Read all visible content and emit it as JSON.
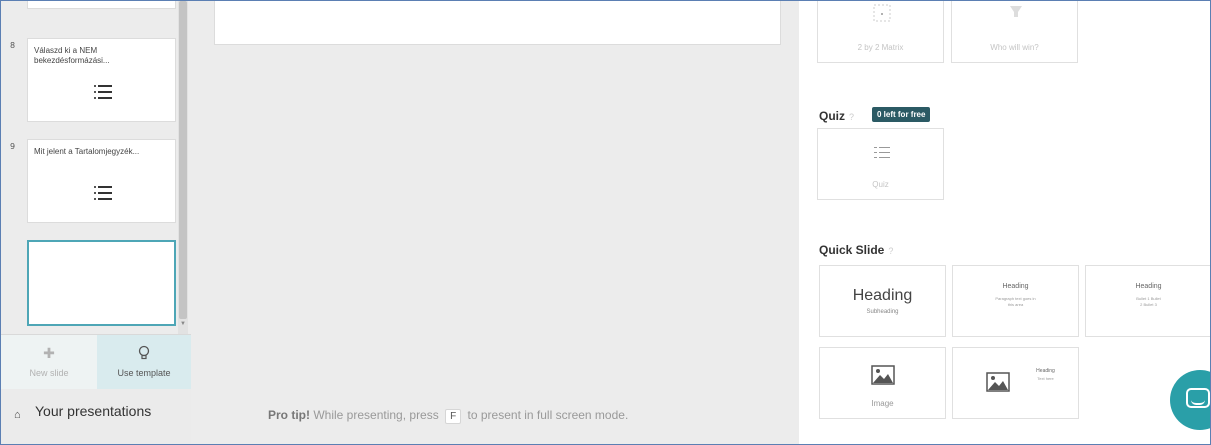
{
  "sidebar": {
    "slides": [
      {
        "number": "8",
        "title": "Válaszd ki a NEM bekezdésformázási..."
      },
      {
        "number": "9",
        "title": "Mit jelent a Tartalomjegyzék..."
      }
    ],
    "new_slide_label": "New slide",
    "use_template_label": "Use template",
    "your_presentations_label": "Your presentations"
  },
  "center": {
    "protip": {
      "bold": "Pro tip!",
      "before": "While presenting, press",
      "key": "F",
      "after": "to present in full screen mode."
    }
  },
  "right_panel": {
    "top_tiles": [
      {
        "label": "2 by 2 Matrix"
      },
      {
        "label": "Who will win?"
      }
    ],
    "quiz": {
      "title": "Quiz",
      "help": "?",
      "badge": "0 left for free",
      "tile_label": "Quiz"
    },
    "quick_slide": {
      "title": "Quick Slide",
      "help": "?",
      "heading_tile": {
        "heading": "Heading",
        "sub": "Subheading"
      },
      "heading_text_tile": {
        "heading": "Heading",
        "text": "Paragraph text goes in this area"
      },
      "heading_bullets_tile": {
        "heading": "Heading",
        "text": "Bullet 1 Bullet 2 Bullet 3"
      },
      "image_tile": {
        "label": "Image"
      },
      "image_text_tile": {
        "heading": "Heading",
        "text": "Text here"
      }
    }
  },
  "colors": {
    "accent": "#2a9fa8",
    "badge_bg": "#2b5a64",
    "selected_slide_border": "#4ea6b6"
  }
}
